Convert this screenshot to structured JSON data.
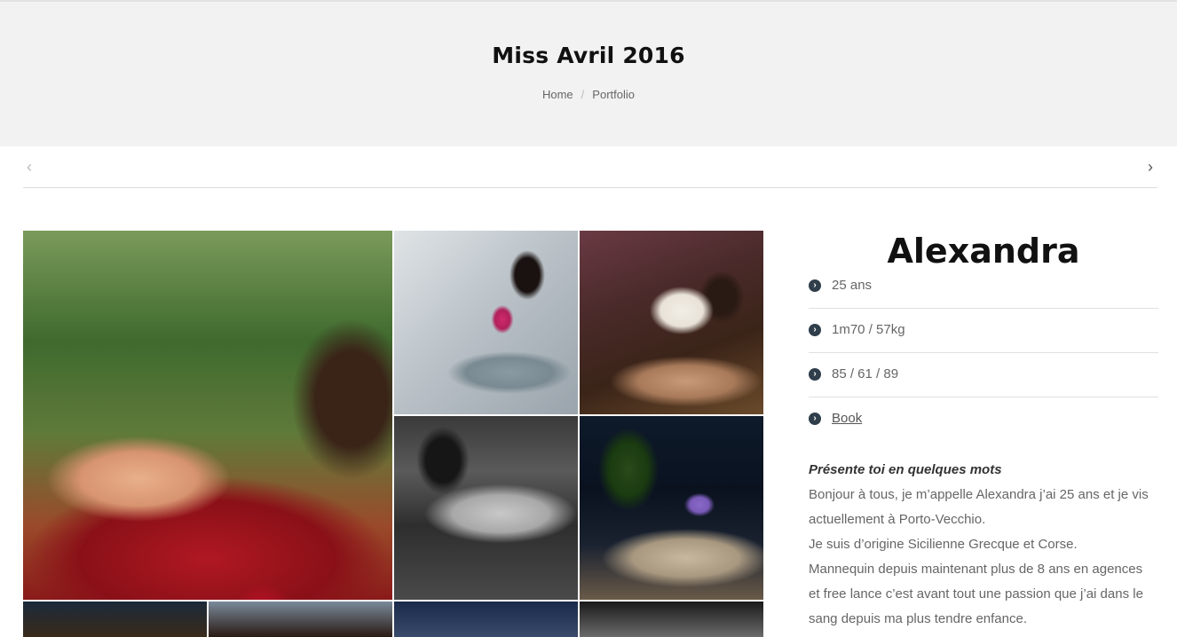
{
  "header": {
    "title": "Miss Avril 2016",
    "breadcrumb": {
      "home": "Home",
      "separator": "/",
      "current": "Portfolio"
    }
  },
  "pager": {
    "prev_icon": "chevron-left-icon",
    "next_icon": "chevron-right-icon",
    "prev": "‹",
    "next": "›"
  },
  "gallery": {
    "images": [
      "main-photo",
      "photo-2",
      "photo-3",
      "photo-4",
      "photo-5",
      "photo-6",
      "photo-7",
      "photo-8",
      "photo-9"
    ]
  },
  "profile": {
    "name": "Alexandra",
    "bullet_icon": "chevron-circle-right-icon",
    "bullet": "›",
    "age": "25 ans",
    "height_weight": "1m70 / 57kg",
    "measurements": "85 / 61 / 89",
    "book_link": "Book"
  },
  "bio": {
    "question": "Présente toi en quelques mots",
    "lines": [
      "Bonjour à tous, je m’appelle Alexandra j’ai 25 ans et je vis",
      "actuellement à Porto-Vecchio.",
      "Je suis d’origine Sicilienne Grecque et Corse.",
      "Mannequin depuis maintenant plus de 8 ans en agences",
      "et free lance c’est avant tout une passion que j’ai dans le",
      "sang depuis ma plus tendre enfance."
    ]
  },
  "colors": {
    "hero_bg": "#f2f2f2",
    "bullet": "#2f3e4a",
    "rule": "#dcdcdc"
  }
}
